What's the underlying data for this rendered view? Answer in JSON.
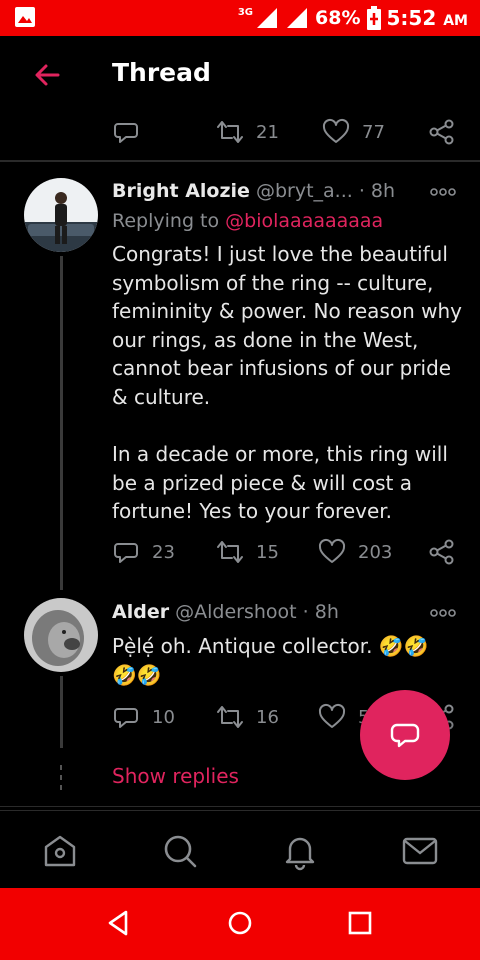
{
  "status_bar": {
    "network": "3G",
    "battery": "68%",
    "time": "5:52",
    "ampm": "AM"
  },
  "header": {
    "title": "Thread"
  },
  "top_actions": {
    "reply_count": "",
    "retweet_count": "21",
    "like_count": "77"
  },
  "tweets": [
    {
      "name": "Bright Alozie",
      "handle": "@bryt_a...",
      "time": "· 8h",
      "replying_label": "Replying to",
      "replying_to": "@biolaaaaaaaaa",
      "body": "Congrats! I just love the beautiful symbolism of the ring -- culture, femininity & power. No reason why our rings, as done in the West, cannot bear infusions of our pride & culture.\n\nIn a decade or more, this ring will be a prized piece & will cost a fortune! Yes to your forever.",
      "reply_count": "23",
      "retweet_count": "15",
      "like_count": "203"
    },
    {
      "name": "Alder",
      "handle": "@Aldershoot",
      "time": "· 8h",
      "body": "Pẹ̀lẹ́ oh. Antique collector. 🤣🤣\n🤣🤣",
      "reply_count": "10",
      "retweet_count": "16",
      "like_count": "5"
    }
  ],
  "show_replies": "Show replies",
  "colors": {
    "accent": "#e0245e",
    "status_bar": "#f20000",
    "background": "#000000",
    "muted": "#8a8d91"
  },
  "icons": {
    "back": "arrow-left-icon",
    "reply": "comment-icon",
    "retweet": "retweet-icon",
    "like": "heart-icon",
    "share": "share-icon",
    "compose": "compose-reply-icon",
    "nav": [
      "home-icon",
      "search-icon",
      "bell-icon",
      "mail-icon"
    ]
  }
}
